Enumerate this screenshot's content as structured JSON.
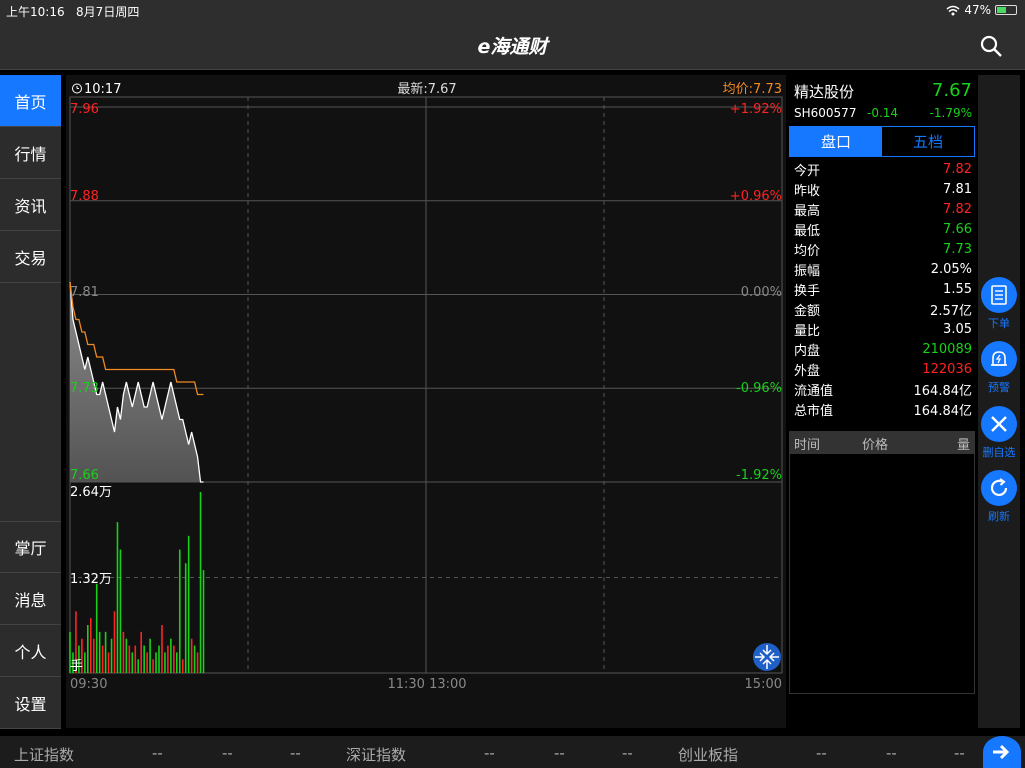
{
  "status_bar": {
    "time": "上午10:16",
    "date": "8月7日周四",
    "battery": "47%",
    "battery_level": 0.47
  },
  "header": {
    "logo_text": "e海通财"
  },
  "nav": {
    "items": [
      {
        "label": "首页",
        "active": true
      },
      {
        "label": "行情"
      },
      {
        "label": "资讯"
      },
      {
        "label": "交易"
      }
    ],
    "bottom_items": [
      {
        "label": "掌厅"
      },
      {
        "label": "消息"
      },
      {
        "label": "个人"
      },
      {
        "label": "设置"
      }
    ]
  },
  "chart_header": {
    "time": "10:17",
    "latest": "最新:7.67",
    "avg": "均价:7.73"
  },
  "chart_data": {
    "type": "line",
    "price_axis_left": [
      "7.96",
      "7.88",
      "7.81",
      "7.73",
      "7.66"
    ],
    "pct_axis_right": [
      "+1.92%",
      "+0.96%",
      "0.00%",
      "-0.96%",
      "-1.92%"
    ],
    "price_range": [
      7.66,
      7.96
    ],
    "prev_close": 7.81,
    "time_labels": [
      "09:30",
      "11:30 13:00",
      "15:00"
    ],
    "volume_labels": [
      "2.64万",
      "1.32万",
      "手"
    ],
    "volume_max": 26400,
    "total_minutes": 240,
    "price_series": [
      7.82,
      7.79,
      7.78,
      7.77,
      7.76,
      7.75,
      7.76,
      7.75,
      7.74,
      7.73,
      7.73,
      7.74,
      7.73,
      7.72,
      7.71,
      7.7,
      7.72,
      7.71,
      7.73,
      7.74,
      7.73,
      7.72,
      7.73,
      7.74,
      7.73,
      7.72,
      7.72,
      7.73,
      7.74,
      7.73,
      7.72,
      7.71,
      7.72,
      7.73,
      7.74,
      7.73,
      7.72,
      7.71,
      7.71,
      7.7,
      7.69,
      7.7,
      7.69,
      7.68,
      7.66,
      7.66
    ],
    "avg_series": [
      7.82,
      7.8,
      7.79,
      7.79,
      7.78,
      7.78,
      7.77,
      7.77,
      7.77,
      7.76,
      7.76,
      7.76,
      7.75,
      7.75,
      7.75,
      7.75,
      7.75,
      7.75,
      7.75,
      7.75,
      7.75,
      7.75,
      7.75,
      7.75,
      7.75,
      7.75,
      7.75,
      7.75,
      7.75,
      7.75,
      7.75,
      7.75,
      7.75,
      7.75,
      7.75,
      7.75,
      7.74,
      7.74,
      7.74,
      7.74,
      7.74,
      7.74,
      7.74,
      7.73,
      7.73,
      7.73
    ],
    "volume_series": [
      6000,
      3000,
      9000,
      4000,
      5000,
      3000,
      7000,
      8000,
      5000,
      13000,
      6000,
      4000,
      6000,
      3000,
      5000,
      9000,
      22000,
      18000,
      6000,
      5000,
      4000,
      3000,
      4000,
      2000,
      6000,
      4000,
      3000,
      5000,
      2000,
      3000,
      4000,
      7000,
      3000,
      4000,
      5000,
      4000,
      3000,
      18000,
      2000,
      16000,
      20000,
      5000,
      4000,
      3000,
      26400,
      15000
    ],
    "volume_colors": [
      "g",
      "g",
      "r",
      "g",
      "r",
      "g",
      "g",
      "r",
      "r",
      "g",
      "g",
      "r",
      "g",
      "r",
      "g",
      "r",
      "g",
      "g",
      "r",
      "g",
      "r",
      "g",
      "r",
      "g",
      "r",
      "g",
      "r",
      "g",
      "r",
      "g",
      "g",
      "r",
      "g",
      "r",
      "g",
      "r",
      "g",
      "g",
      "r",
      "g",
      "g",
      "r",
      "g",
      "r",
      "g",
      "g"
    ]
  },
  "quote": {
    "name": "精达股份",
    "price": "7.67",
    "code": "SH600577",
    "change": "-0.14",
    "change_pct": "-1.79%",
    "tabs": [
      "盘口",
      "五档"
    ],
    "rows": [
      {
        "label": "今开",
        "value": "7.82",
        "color": "red"
      },
      {
        "label": "昨收",
        "value": "7.81",
        "color": "white"
      },
      {
        "label": "最高",
        "value": "7.82",
        "color": "red"
      },
      {
        "label": "最低",
        "value": "7.66",
        "color": "green"
      },
      {
        "label": "均价",
        "value": "7.73",
        "color": "green"
      },
      {
        "label": "振幅",
        "value": "2.05%",
        "color": "white"
      },
      {
        "label": "换手",
        "value": "1.55",
        "color": "white"
      },
      {
        "label": "金额",
        "value": "2.57亿",
        "color": "white"
      },
      {
        "label": "量比",
        "value": "3.05",
        "color": "white"
      },
      {
        "label": "内盘",
        "value": "210089",
        "color": "green"
      },
      {
        "label": "外盘",
        "value": "122036",
        "color": "red"
      },
      {
        "label": "流通值",
        "value": "164.84亿",
        "color": "white"
      },
      {
        "label": "总市值",
        "value": "164.84亿",
        "color": "white"
      }
    ],
    "tick_headers": [
      "时间",
      "价格",
      "量"
    ]
  },
  "actions": [
    {
      "label": "下单",
      "icon": "order-icon"
    },
    {
      "label": "预警",
      "icon": "alarm-bell-icon"
    },
    {
      "label": "删自选",
      "icon": "close-icon"
    },
    {
      "label": "刷新",
      "icon": "refresh-icon"
    }
  ],
  "ticker": {
    "items": [
      {
        "name": "上证指数",
        "v1": "--",
        "v2": "--",
        "v3": "--"
      },
      {
        "name": "深证指数",
        "v1": "--",
        "v2": "--",
        "v3": "--"
      },
      {
        "name": "创业板指",
        "v1": "--",
        "v2": "--",
        "v3": "--"
      }
    ]
  },
  "colors": {
    "accent": "#1677ff",
    "up": "#ff2323",
    "down": "#19d119",
    "avg_line": "#f08a24"
  }
}
